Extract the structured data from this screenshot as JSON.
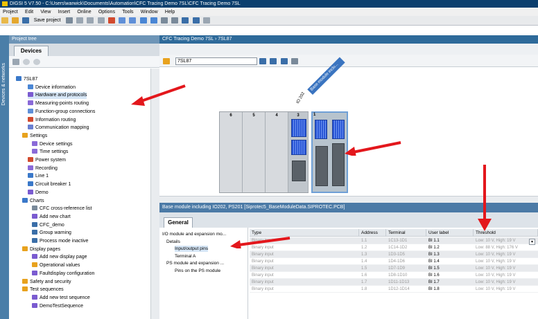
{
  "window": {
    "title": "DIGSI 5 V7.50 - C:\\Users\\warwick\\Documents\\Automation\\CFC Tracing Demo 7SL\\CFC Tracing Demo 7SL"
  },
  "menu": [
    "Project",
    "Edit",
    "View",
    "Insert",
    "Online",
    "Options",
    "Tools",
    "Window",
    "Help"
  ],
  "toolbar": {
    "save_label": "Save project"
  },
  "left_strip": {
    "label": "Devices & networks"
  },
  "project_tree": {
    "header": "Project tree",
    "tab": "Devices",
    "items": [
      {
        "label": "7SL87",
        "level": 0,
        "icon_color": "#3a78c9"
      },
      {
        "label": "Device information",
        "level": 2,
        "icon_color": "#4a86d4"
      },
      {
        "label": "Hardware and protocols",
        "level": 2,
        "icon_color": "#7a5bd0",
        "selected": true
      },
      {
        "label": "Measuring-points routing",
        "level": 2,
        "icon_color": "#8a6ad8"
      },
      {
        "label": "Function-group connections",
        "level": 2,
        "icon_color": "#5f8fd8"
      },
      {
        "label": "Information routing",
        "level": 2,
        "icon_color": "#d24a2e"
      },
      {
        "label": "Communication mapping",
        "level": 2,
        "icon_color": "#6a7fd0"
      },
      {
        "label": "Settings",
        "level": 1,
        "icon_color": "#e8a21e"
      },
      {
        "label": "Device settings",
        "level": 3,
        "icon_color": "#8a6ad8"
      },
      {
        "label": "Time settings",
        "level": 3,
        "icon_color": "#8a6ad8"
      },
      {
        "label": "Power system",
        "level": 2,
        "icon_color": "#d24a2e"
      },
      {
        "label": "Recording",
        "level": 2,
        "icon_color": "#8a6ad8"
      },
      {
        "label": "Line 1",
        "level": 2,
        "icon_color": "#3a78c9"
      },
      {
        "label": "Circuit breaker 1",
        "level": 2,
        "icon_color": "#3a78c9"
      },
      {
        "label": "Demo",
        "level": 2,
        "icon_color": "#7a5bd0"
      },
      {
        "label": "Charts",
        "level": 1,
        "icon_color": "#3a78c9"
      },
      {
        "label": "CFC cross-reference list",
        "level": 3,
        "icon_color": "#7a8a9a"
      },
      {
        "label": "Add new chart",
        "level": 3,
        "icon_color": "#7a5bd0"
      },
      {
        "label": "CFC_demo",
        "level": 3,
        "icon_color": "#3a6ea8"
      },
      {
        "label": "Group warning",
        "level": 3,
        "icon_color": "#3a6ea8"
      },
      {
        "label": "Process mode inactive",
        "level": 3,
        "icon_color": "#3a6ea8"
      },
      {
        "label": "Display pages",
        "level": 1,
        "icon_color": "#e8a21e"
      },
      {
        "label": "Add new display page",
        "level": 3,
        "icon_color": "#7a5bd0"
      },
      {
        "label": "Operational values",
        "level": 3,
        "icon_color": "#e8a21e"
      },
      {
        "label": "Faultdisplay configuration",
        "level": 3,
        "icon_color": "#7a5bd0"
      },
      {
        "label": "Safety and security",
        "level": 1,
        "icon_color": "#e8a21e"
      },
      {
        "label": "Test sequences",
        "level": 1,
        "icon_color": "#e8a21e"
      },
      {
        "label": "Add new test sequence",
        "level": 3,
        "icon_color": "#7a5bd0"
      },
      {
        "label": "DemoTestSequence",
        "level": 3,
        "icon_color": "#7a5bd0"
      }
    ]
  },
  "editor": {
    "breadcrumb": "CFC Tracing Demo 7SL  ›  7SL87",
    "device_select": "7SL87",
    "slot_numbers": [
      "6",
      "5",
      "4",
      "3",
      "1"
    ],
    "io_label": "IO 202",
    "base_module_label": "Base module inclu..."
  },
  "properties": {
    "header": "Base module including IO202, PS201 [Siprotec5_BaseModuleData.SIPROTEC.PCB]",
    "tab": "General",
    "nav": [
      {
        "label": "I/O module and expansion mo...",
        "level": 0
      },
      {
        "label": "Details",
        "level": 1
      },
      {
        "label": "Input/output pins",
        "level": 2,
        "selected": true
      },
      {
        "label": "Terminal A",
        "level": 2
      },
      {
        "label": "PS module and expansion ...",
        "level": 1
      },
      {
        "label": "Pins on the PS module",
        "level": 2
      }
    ],
    "columns": [
      "Type",
      "Address",
      "Terminal",
      "User label",
      "Threshold"
    ],
    "rows": [
      {
        "type": "Binary input",
        "address": "1.1",
        "terminal": "1C13-1D1",
        "user_label": "BI 1.1",
        "threshold": "Low: 10 V, High: 19 V"
      },
      {
        "type": "Binary input",
        "address": "1.2",
        "terminal": "1C14-1D2",
        "user_label": "BI 1.2",
        "threshold": "Low: 88 V, High: 176 V"
      },
      {
        "type": "Binary input",
        "address": "1.3",
        "terminal": "1D3-1D5",
        "user_label": "BI 1.3",
        "threshold": "Low: 10 V, High: 19 V"
      },
      {
        "type": "Binary input",
        "address": "1.4",
        "terminal": "1D4-1D6",
        "user_label": "BI 1.4",
        "threshold": "Low: 10 V, High: 19 V"
      },
      {
        "type": "Binary input",
        "address": "1.5",
        "terminal": "1D7-1D9",
        "user_label": "BI 1.5",
        "threshold": "Low: 10 V, High: 19 V"
      },
      {
        "type": "Binary input",
        "address": "1.6",
        "terminal": "1D8-1D10",
        "user_label": "BI 1.6",
        "threshold": "Low: 10 V, High: 19 V"
      },
      {
        "type": "Binary input",
        "address": "1.7",
        "terminal": "1D11-1D13",
        "user_label": "BI 1.7",
        "threshold": "Low: 10 V, High: 19 V"
      },
      {
        "type": "Binary input",
        "address": "1.8",
        "terminal": "1D12-1D14",
        "user_label": "BI 1.8",
        "threshold": "Low: 10 V, High: 19 V"
      }
    ]
  },
  "colors": {
    "accent": "#2e6a9a",
    "arrow": "#e3171c",
    "module_blue": "#2a56d6"
  }
}
